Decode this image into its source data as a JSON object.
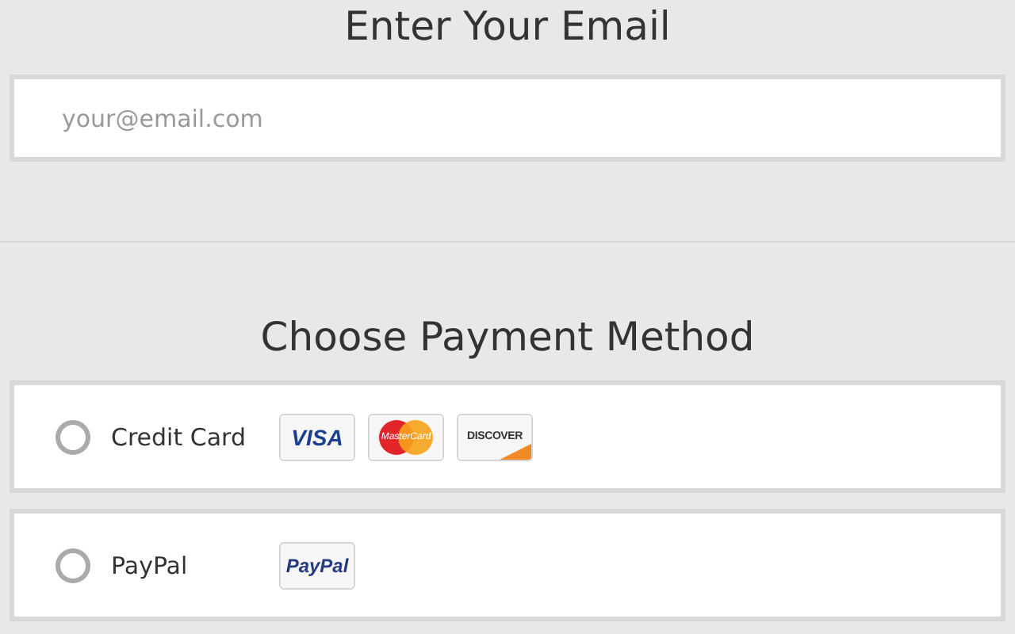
{
  "email_section": {
    "title": "Enter Your Email",
    "field": {
      "placeholder": "your@email.com"
    }
  },
  "payment_section": {
    "title": "Choose Payment Method",
    "methods": [
      {
        "label": "Credit Card",
        "selected": false,
        "cards": [
          {
            "kind": "visa",
            "label": "VISA"
          },
          {
            "kind": "mastercard",
            "label": "MasterCard"
          },
          {
            "kind": "discover",
            "label": "DISCOVER"
          }
        ]
      },
      {
        "label": "PayPal",
        "selected": false,
        "cards": [
          {
            "kind": "paypal",
            "label": "PayPal"
          }
        ]
      }
    ]
  }
}
